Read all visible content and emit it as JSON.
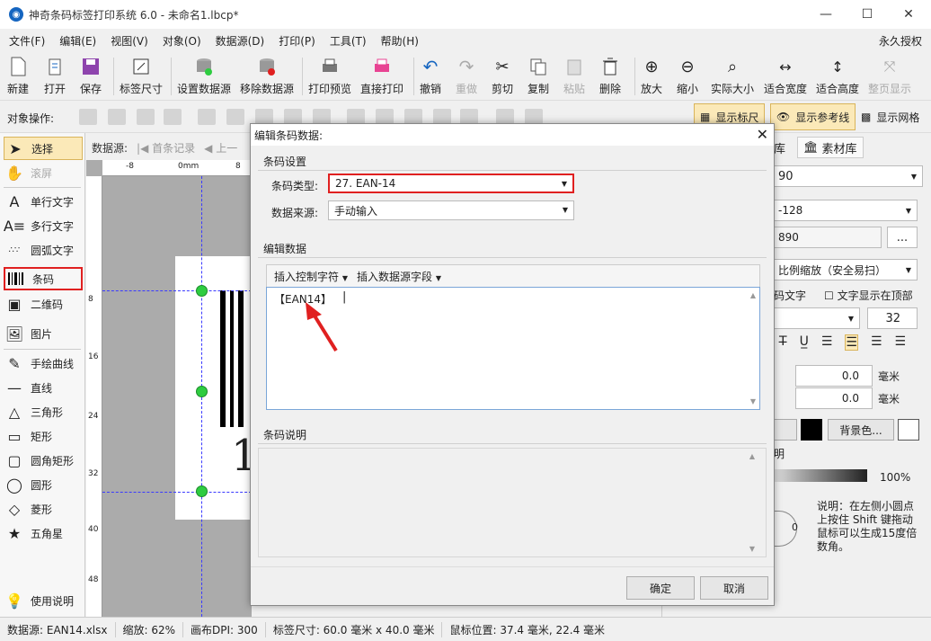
{
  "window": {
    "title": "神奇条码标签打印系统 6.0 - 未命名1.lbcp*",
    "min": "—",
    "max": "☐",
    "close": "✕"
  },
  "menu": [
    "文件(F)",
    "编辑(E)",
    "视图(V)",
    "对象(O)",
    "数据源(D)",
    "打印(P)",
    "工具(T)",
    "帮助(H)"
  ],
  "license": "永久授权",
  "toolbar": {
    "new": "新建",
    "open": "打开",
    "save": "保存",
    "label_size": "标签尺寸",
    "set_ds": "设置数据源",
    "remove_ds": "移除数据源",
    "preview": "打印预览",
    "print": "直接打印",
    "undo": "撤销",
    "redo": "重做",
    "cut": "剪切",
    "copy": "复制",
    "paste": "粘贴",
    "delete": "删除",
    "zoom_in": "放大",
    "zoom_out": "缩小",
    "actual": "实际大小",
    "fit_w": "适合宽度",
    "fit_h": "适合高度",
    "full": "整页显示"
  },
  "objbar": {
    "label": "对象操作:",
    "show_ruler": "显示标尺",
    "show_guides": "显示参考线",
    "show_grid": "显示网格"
  },
  "tools": {
    "select": "选择",
    "scroll": "滚屏",
    "single_text": "单行文字",
    "multi_text": "多行文字",
    "arc_text": "圆弧文字",
    "barcode": "条码",
    "qrcode": "二维码",
    "image": "图片",
    "freehand": "手绘曲线",
    "line": "直线",
    "triangle": "三角形",
    "rect": "矩形",
    "roundrect": "圆角矩形",
    "circle": "圆形",
    "diamond": "菱形",
    "star": "五角星",
    "help": "使用说明"
  },
  "datasource_bar": {
    "label": "数据源:",
    "first": "首条记录",
    "prev": "上一"
  },
  "ruler": {
    "h": [
      "-8",
      "0mm",
      "8"
    ],
    "v": [
      "8",
      "16",
      "24",
      "32",
      "40",
      "48"
    ]
  },
  "label_text": "1",
  "right_panel": {
    "tab_lib": "库",
    "tab_material": "素材库",
    "f1": "90",
    "f2": "-128",
    "f3": "890",
    "more": "...",
    "scale": "比例缩放（安全易扫）",
    "cb_text": "码文字",
    "cb_top": "文字显示在顶部",
    "font_size": "32",
    "v1": "0.0",
    "v2": "0.0",
    "unit": "毫米",
    "colon": "ᵢ:",
    "bg_color": "背景色...",
    "clear": "明",
    "opacity": "100%",
    "rotate_val": "0",
    "help_text": "说明：在左侧小圆点上按住 Shift 键拖动鼠标可以生成15度倍数角。"
  },
  "dialog": {
    "title": "编辑条码数据:",
    "group_settings": "条码设置",
    "type_label": "条码类型:",
    "type_value": "27. EAN-14",
    "source_label": "数据来源:",
    "source_value": "手动输入",
    "group_edit": "编辑数据",
    "insert_ctrl": "插入控制字符",
    "insert_field": "插入数据源字段",
    "editor_value": "【EAN14】",
    "group_desc": "条码说明",
    "ok": "确定",
    "cancel": "取消"
  },
  "status": {
    "ds": "数据源: EAN14.xlsx",
    "zoom": "缩放: 62%",
    "dpi": "画布DPI: 300",
    "size": "标签尺寸: 60.0 毫米 x 40.0 毫米",
    "mouse": "鼠标位置: 37.4 毫米, 22.4 毫米"
  },
  "colors": {
    "highlight": "#e02020",
    "handle": "#2ecc40",
    "accent": "#1565c0"
  }
}
